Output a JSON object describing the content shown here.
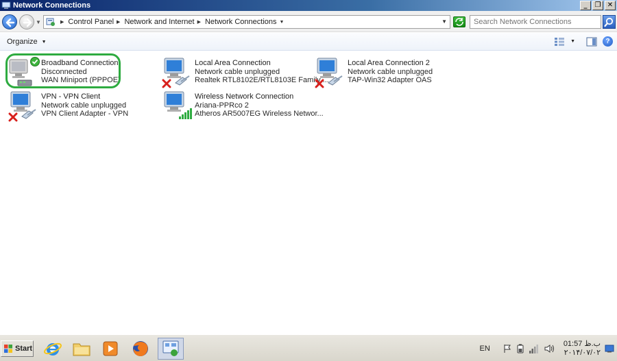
{
  "window": {
    "title": "Network Connections"
  },
  "titlebar_buttons": {
    "minimize": "_",
    "restore": "❐",
    "close": "✕"
  },
  "address": {
    "crumbs": [
      "Control Panel",
      "Network and Internet",
      "Network Connections"
    ]
  },
  "search": {
    "placeholder": "Search Network Connections"
  },
  "toolbar": {
    "organize_label": "Organize"
  },
  "connections": [
    {
      "name": "Broadband Connection",
      "status": "Disconnected",
      "device": "WAN Miniport (PPPOE)",
      "icon": "broadband-icon",
      "badge": "check"
    },
    {
      "name": "Local Area Connection",
      "status": "Network cable unplugged",
      "device": "Realtek RTL8102E/RTL8103E Family ...",
      "icon": "lan-icon",
      "badge": "x"
    },
    {
      "name": "Local Area Connection 2",
      "status": "Network cable unplugged",
      "device": "TAP-Win32 Adapter OAS",
      "icon": "lan-icon",
      "badge": "x"
    },
    {
      "name": "VPN - VPN Client",
      "status": "Network cable unplugged",
      "device": "VPN Client Adapter - VPN",
      "icon": "lan-icon",
      "badge": "x"
    },
    {
      "name": "Wireless Network Connection",
      "status": "Ariana-PPRco  2",
      "device": "Atheros AR5007EG Wireless Networ...",
      "icon": "wireless-icon",
      "badge": "signal"
    }
  ],
  "taskbar": {
    "start_label": "Start",
    "language": "EN",
    "clock_time": "01:57 ب.ظ",
    "clock_date": "۲۰۱۴/۰۷/۰۲"
  },
  "colors": {
    "highlight_ring": "#2eab40",
    "title_start": "#0a246a",
    "title_end": "#a6caf0",
    "error_x": "#d8201c"
  }
}
